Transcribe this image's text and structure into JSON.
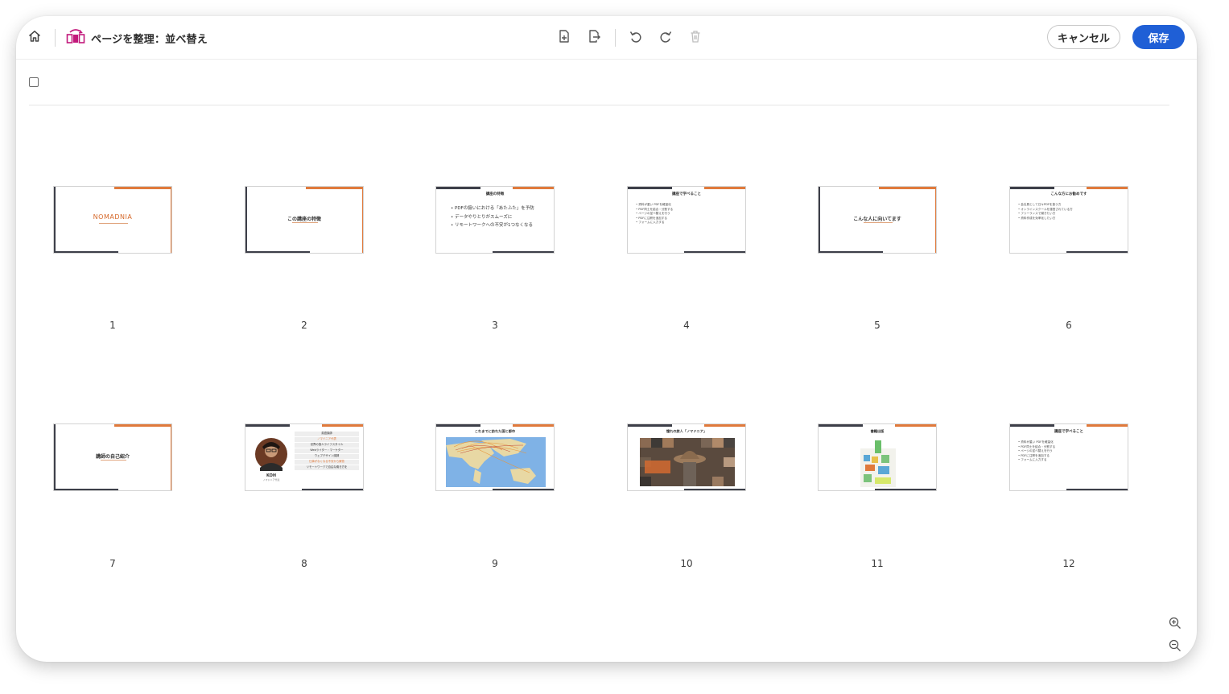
{
  "toolbar": {
    "title": "ページを整理：並べ替え",
    "cancel_label": "キャンセル",
    "save_label": "保存"
  },
  "colors": {
    "accent": "#1f5fd6",
    "slide_orange": "#e07a3c",
    "slide_dark": "#3d3f49",
    "logo_pink": "#c2187b"
  },
  "pages": [
    {
      "num": "1",
      "logo": "NOMADNIA"
    },
    {
      "num": "2",
      "title": "この講座の特徴"
    },
    {
      "num": "3",
      "title": "講座の特徴",
      "bullets": [
        "PDFの扱いにおける「あたふた」を予防",
        "データやりとりがスムーズに",
        "リモートワークへの不安が1つなくなる"
      ]
    },
    {
      "num": "4",
      "title": "講座で学べること",
      "bullets": [
        "資料が重い PDFを軽量化",
        "PDF同士を結合・分割する",
        "ページの並べ替えを行う",
        "PDFに注釈を追加する",
        "フォームに入力する"
      ]
    },
    {
      "num": "5",
      "title": "こんな人に向いてます"
    },
    {
      "num": "6",
      "title": "こんな方にお勧めです",
      "bullets": [
        "会社員として日々PDFを扱う方",
        "オンラインスクールを運営されている方",
        "フリーランスで働きたい方",
        "資料作成を効率化したい方"
      ]
    },
    {
      "num": "7",
      "title": "講師の自己紹介"
    },
    {
      "num": "8",
      "name": "KOH",
      "subtitle": "ノマドニア代表",
      "items": [
        "英語講師",
        "ノマドニア代表",
        "世界の旅人ライフスタイル",
        "Webライター・マーケター",
        "ウェブデザイン講師",
        "仕事がなくなる不安から解放",
        "リモートワークで自由な働き方を"
      ]
    },
    {
      "num": "9",
      "title": "これまでに訪れた国と都市"
    },
    {
      "num": "10",
      "title": "憧れの旅人「ノマドニア」"
    },
    {
      "num": "11",
      "title": "書籍出版"
    },
    {
      "num": "12",
      "title": "講座で学べること",
      "bullets": [
        "資料が重い PDFを軽量化",
        "PDF同士を結合・分割する",
        "ページの並べ替えを行う",
        "PDFに注釈を追加する",
        "フォームに入力する"
      ]
    }
  ]
}
